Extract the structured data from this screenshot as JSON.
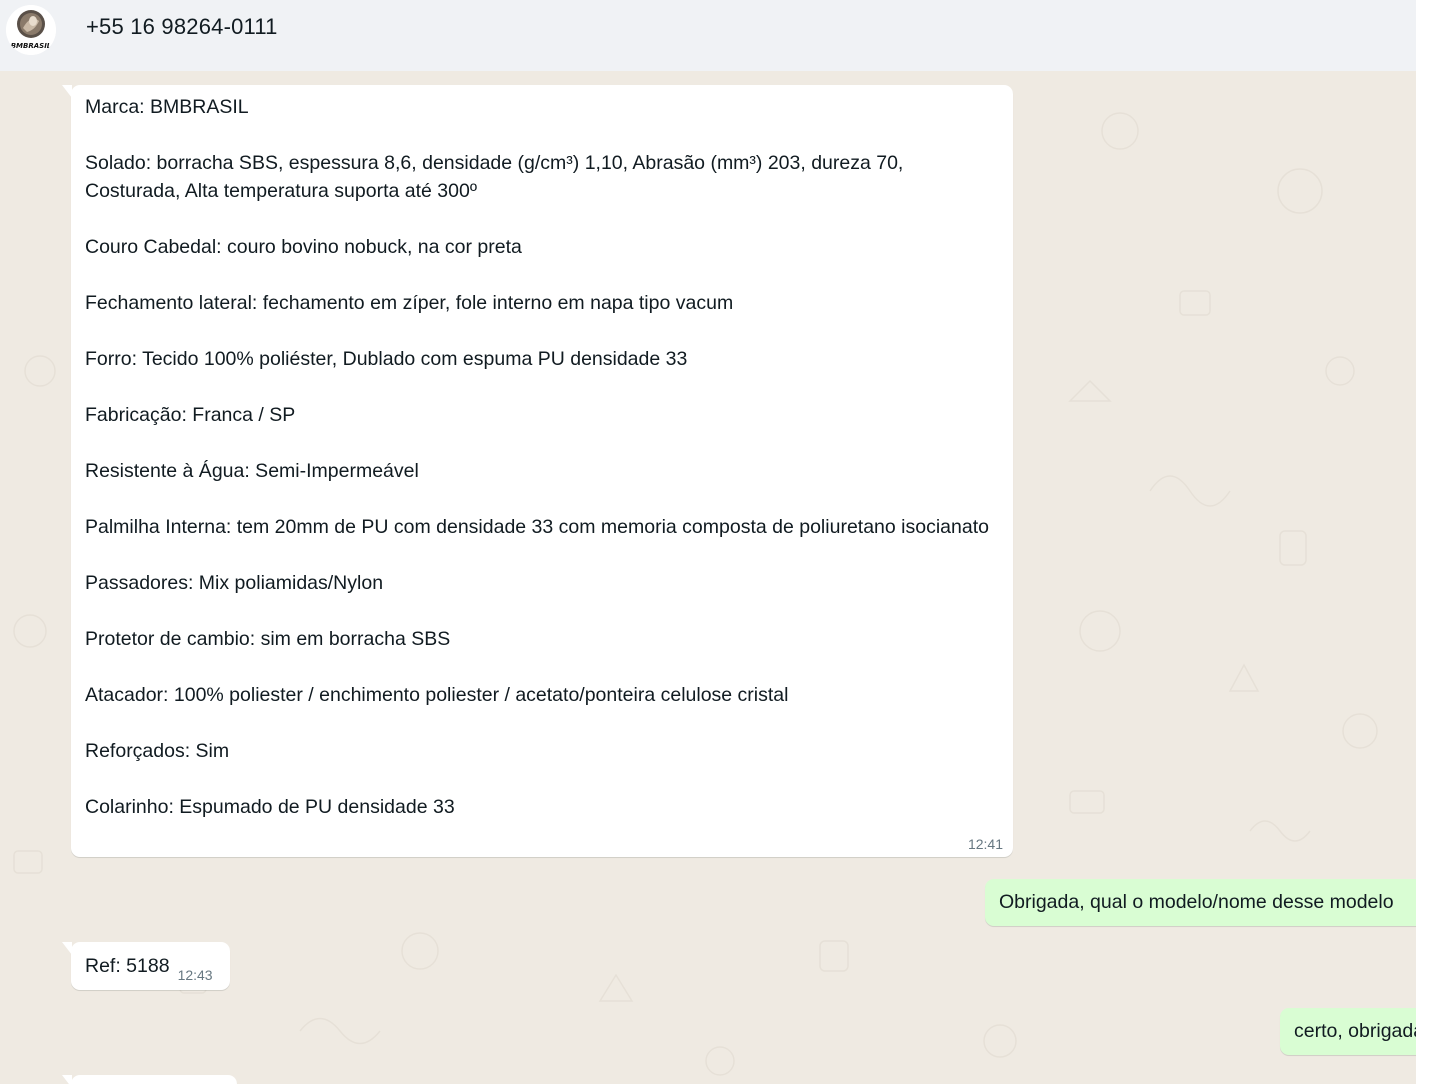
{
  "header": {
    "contact_name": "+55 16 98264-0111",
    "avatar_text": "BMBRASIL"
  },
  "messages": [
    {
      "direction": "incoming",
      "lines": [
        "Marca: BMBRASIL",
        "",
        "Solado: borracha SBS, espessura 8,6, densidade (g/cm³) 1,10, Abrasão (mm³) 203, dureza 70, Costurada, Alta temperatura suporta até 300º",
        "",
        "Couro Cabedal: couro bovino nobuck, na cor preta",
        "",
        "Fechamento lateral: fechamento em zíper, fole interno em napa tipo vacum",
        "",
        "Forro: Tecido 100% poliéster, Dublado com espuma PU densidade 33",
        "",
        "Fabricação: Franca / SP",
        "",
        "Resistente à Água: Semi-Impermeável",
        "",
        "Palmilha Interna: tem 20mm de PU com densidade 33 com memoria composta de poliuretano isocianato",
        "",
        "Passadores: Mix poliamidas/Nylon",
        "",
        "Protetor de cambio: sim em borracha SBS",
        "",
        "Atacador: 100% poliester / enchimento poliester / acetato/ponteira celulose cristal",
        "",
        "Reforçados: Sim",
        "",
        "Colarinho: Espumado de PU densidade 33"
      ],
      "time": "12:41"
    },
    {
      "direction": "outgoing",
      "text": "Obrigada, qual o modelo/nome desse modelo"
    },
    {
      "direction": "incoming",
      "text": "Ref: 5188",
      "time": "12:43"
    },
    {
      "direction": "outgoing",
      "text": "certo, obrigada"
    }
  ],
  "colors": {
    "header_bg": "#f0f2f5",
    "chat_bg": "#efeae2",
    "incoming_bubble": "#ffffff",
    "outgoing_bubble": "#d9fdd3",
    "text": "#111b21",
    "timestamp": "#667781"
  }
}
